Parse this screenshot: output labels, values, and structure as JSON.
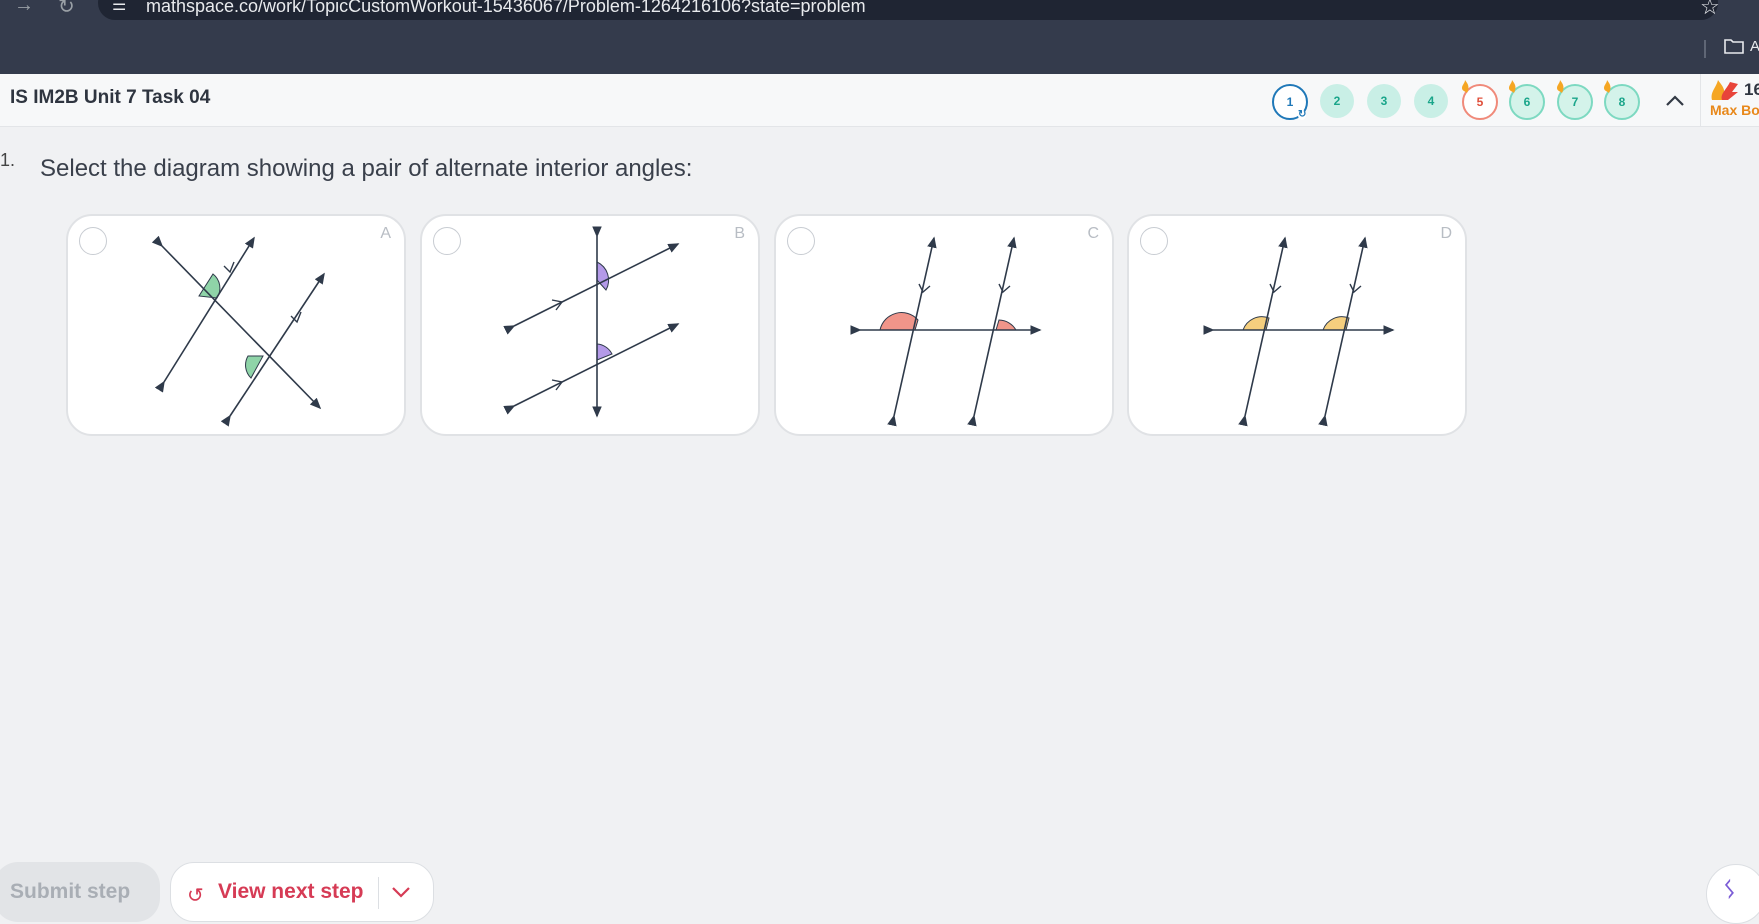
{
  "browser": {
    "url": "mathspace.co/work/TopicCustomWorkout-15436067/Problem-1264216106?state=problem",
    "bookmark_partial": "A"
  },
  "header": {
    "task_title": "IS IM2B Unit 7 Task 04",
    "steps": [
      {
        "label": "1",
        "state": "current"
      },
      {
        "label": "2",
        "state": "done"
      },
      {
        "label": "3",
        "state": "done"
      },
      {
        "label": "4",
        "state": "done"
      },
      {
        "label": "5",
        "state": "wrong"
      },
      {
        "label": "6",
        "state": "fire"
      },
      {
        "label": "7",
        "state": "fire"
      },
      {
        "label": "8",
        "state": "fire"
      }
    ],
    "boost": {
      "count": "16",
      "label": "Max Boost"
    }
  },
  "question": {
    "number": "1.",
    "text": "Select the diagram showing a pair of alternate interior angles:",
    "options": [
      {
        "letter": "A",
        "angle_color": "#8fd4a8"
      },
      {
        "letter": "B",
        "angle_color": "#b49ae8"
      },
      {
        "letter": "C",
        "angle_color": "#f0958a"
      },
      {
        "letter": "D",
        "angle_color": "#f5cf7e"
      }
    ]
  },
  "actions": {
    "submit_label": "Submit step",
    "next_label": "View next step"
  },
  "colors": {
    "accent": "#d63b55",
    "current_step": "#1f78b8",
    "done_step": "#c9efe6"
  }
}
